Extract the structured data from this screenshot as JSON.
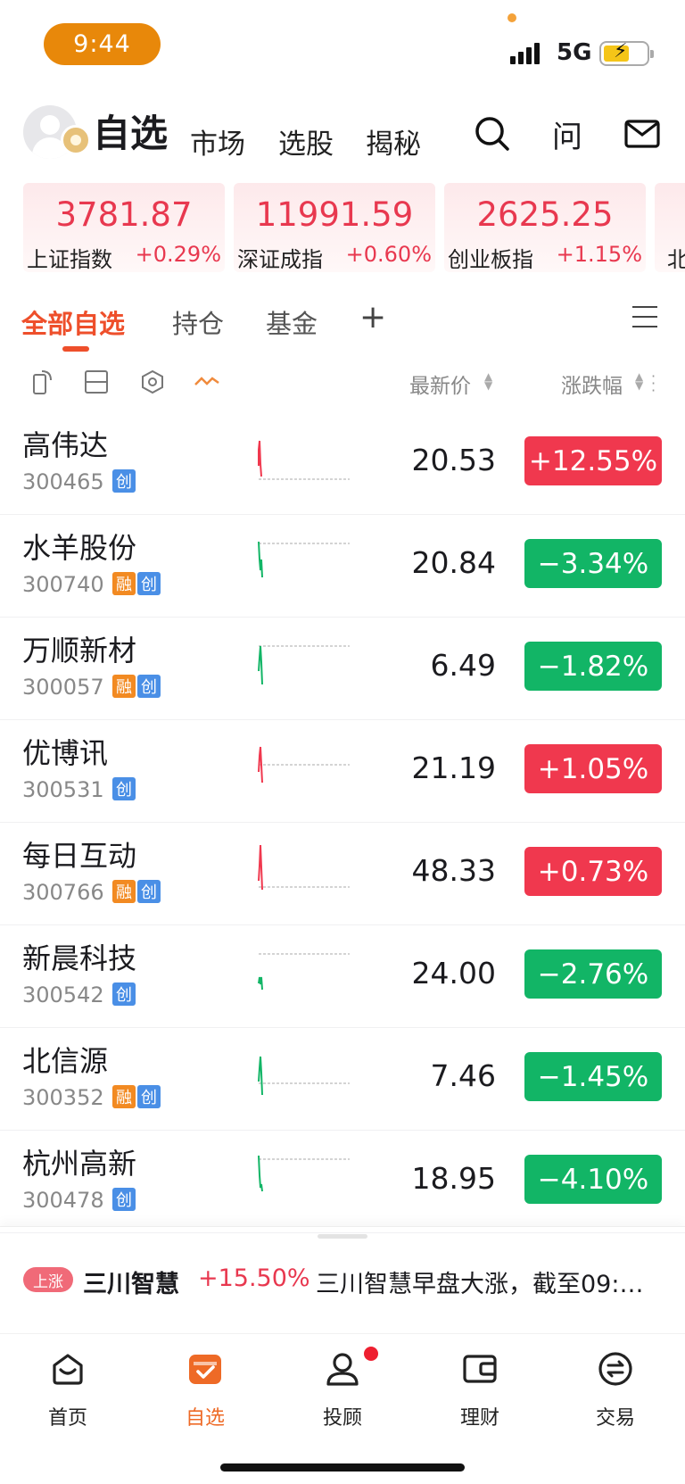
{
  "status_bar": {
    "time": "9:44",
    "network": "5G"
  },
  "header": {
    "title": "自选",
    "tabs": [
      "市场",
      "选股",
      "揭秘"
    ],
    "ask_label": "问"
  },
  "indices": [
    {
      "value": "3781.87",
      "name": "上证指数",
      "change": "+0.29%"
    },
    {
      "value": "11991.59",
      "name": "深证成指",
      "change": "+0.60%"
    },
    {
      "value": "2625.25",
      "name": "创业板指",
      "change": "+1.15%"
    },
    {
      "value": "",
      "name": "北",
      "change": ""
    }
  ],
  "watch_tabs": {
    "all": "全部自选",
    "holdings": "持仓",
    "funds": "基金",
    "add": "+"
  },
  "columns": {
    "price": "最新价",
    "change": "涨跌幅"
  },
  "tag_labels": {
    "rong": "融",
    "chuang": "创"
  },
  "stocks": [
    {
      "name": "高伟达",
      "code": "300465",
      "rong": false,
      "price": "20.53",
      "change": "+12.55%",
      "direction": "up"
    },
    {
      "name": "水羊股份",
      "code": "300740",
      "rong": true,
      "price": "20.84",
      "change": "−3.34%",
      "direction": "down"
    },
    {
      "name": "万顺新材",
      "code": "300057",
      "rong": true,
      "price": "6.49",
      "change": "−1.82%",
      "direction": "down"
    },
    {
      "name": "优博讯",
      "code": "300531",
      "rong": false,
      "price": "21.19",
      "change": "+1.05%",
      "direction": "up"
    },
    {
      "name": "每日互动",
      "code": "300766",
      "rong": true,
      "price": "48.33",
      "change": "+0.73%",
      "direction": "up"
    },
    {
      "name": "新晨科技",
      "code": "300542",
      "rong": false,
      "price": "24.00",
      "change": "−2.76%",
      "direction": "down"
    },
    {
      "name": "北信源",
      "code": "300352",
      "rong": true,
      "price": "7.46",
      "change": "−1.45%",
      "direction": "down"
    },
    {
      "name": "杭州高新",
      "code": "300478",
      "rong": false,
      "price": "18.95",
      "change": "−4.10%",
      "direction": "down"
    }
  ],
  "news": {
    "tag": "上涨",
    "stock": "三川智慧",
    "change": "+15.50%",
    "text": "三川智慧早盘大涨，截至09:…"
  },
  "bottom_nav": [
    {
      "label": "首页",
      "icon": "home-icon"
    },
    {
      "label": "自选",
      "icon": "watchlist-icon",
      "active": true
    },
    {
      "label": "投顾",
      "icon": "advisor-icon"
    },
    {
      "label": "理财",
      "icon": "wallet-icon"
    },
    {
      "label": "交易",
      "icon": "trade-icon"
    }
  ],
  "colors": {
    "up": "#f0384e",
    "down": "#12b566",
    "accent": "#ee4f2b"
  }
}
